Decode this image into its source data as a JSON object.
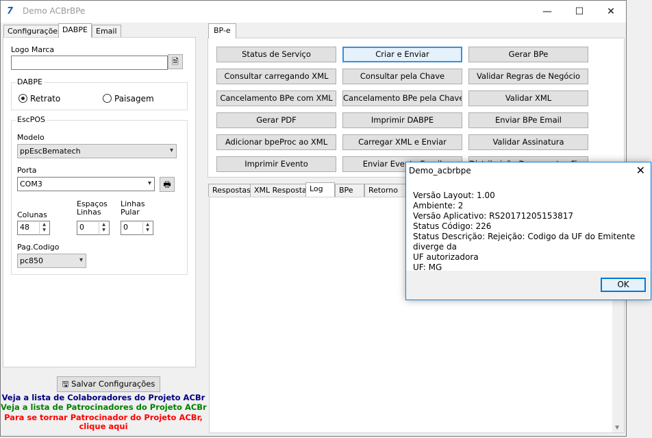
{
  "window": {
    "title": "Demo ACBrBPe",
    "logo": "ACBr-logo-icon",
    "minimize": "—",
    "maximize": "☐",
    "close": "✕"
  },
  "left_tabs": [
    "Configurações",
    "DABPE",
    "Email"
  ],
  "left": {
    "logo_label": "Logo Marca",
    "logo_value": "",
    "dabpe": {
      "title": "DABPE",
      "retrato": "Retrato",
      "paisagem": "Paisagem",
      "selected": "Retrato"
    },
    "escpos": {
      "title": "EscPOS",
      "modelo_label": "Modelo",
      "modelo_value": "ppEscBematech",
      "porta_label": "Porta",
      "porta_value": "COM3",
      "colunas_label": "Colunas",
      "colunas_value": "48",
      "espacos_label_1": "Espaços",
      "espacos_label_2": "Linhas",
      "espacos_value": "0",
      "linhas_label_1": "Linhas",
      "linhas_label_2": "Pular",
      "linhas_value": "0",
      "pagcodigo_label": "Pag.Codigo",
      "pagcodigo_value": "pc850"
    },
    "save_button": "Salvar Configurações",
    "links": {
      "colaboradores": "Veja a lista de Colaboradores do Projeto ACBr",
      "patrocinadores": "Veja a lista de Patrocinadores do Projeto ACBr",
      "tornar_1": "Para se tornar Patrocinador do Projeto ACBr,",
      "tornar_2": "clique aqui"
    },
    "link_colors": {
      "colaboradores": "#000080",
      "patrocinadores": "#008000",
      "tornar": "#ff0000"
    }
  },
  "bpe_tab": "BP-e",
  "buttons": [
    [
      "Status de Serviço",
      "Criar e Enviar",
      "Gerar BPe"
    ],
    [
      "Consultar carregando XML",
      "Consultar pela Chave",
      "Validar Regras de Negócio"
    ],
    [
      "Cancelamento BPe com XML",
      "Cancelamento BPe pela Chave",
      "Validar XML"
    ],
    [
      "Gerar PDF",
      "Imprimir DABPE",
      "Enviar BPe Email"
    ],
    [
      "Adicionar bpeProc ao XML",
      "Carregar XML e Enviar",
      "Validar Assinatura"
    ],
    [
      "Imprimir Evento",
      "Enviar Evento Email",
      "Distribuição Documentos Fiscais"
    ]
  ],
  "bottom_tabs": [
    "Respostas",
    "XML Resposta",
    "Log",
    "BPe",
    "Retorno Co"
  ],
  "active_bottom_tab": "Log",
  "dialog": {
    "title": "Demo_acbrbpe",
    "close": "✕",
    "lines": [
      "Versão Layout: 1.00",
      "Ambiente: 2",
      "Versão Aplicativo: RS20171205153817",
      "Status Código: 226",
      "Status Descrição: Rejeição: Codigo da UF do Emitente diverge da",
      "UF autorizadora",
      "UF: MG"
    ],
    "ok": "OK"
  },
  "scroll": {
    "up": "▲",
    "down": "▼"
  }
}
